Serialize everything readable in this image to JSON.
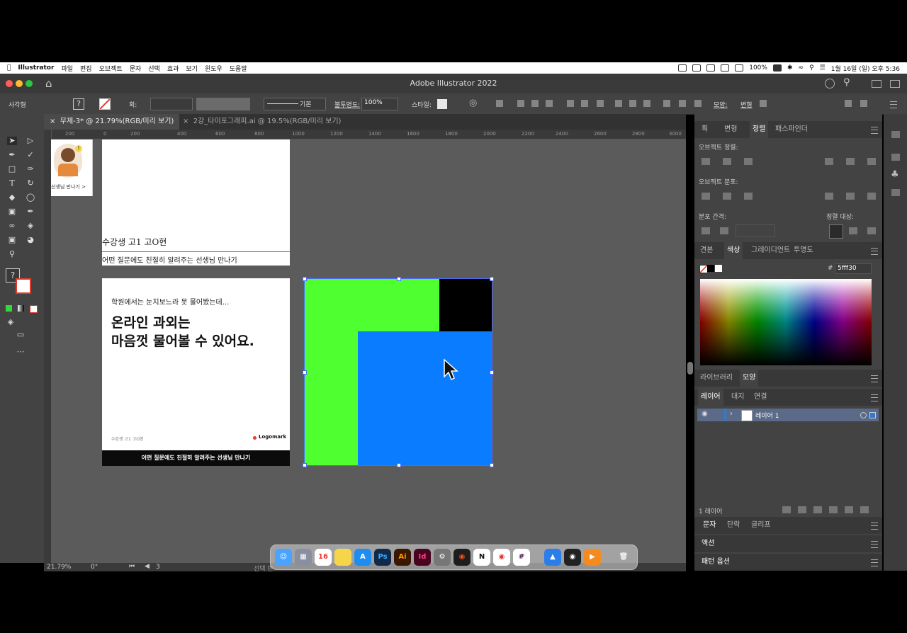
{
  "menubar": {
    "app_name": "Illustrator",
    "items": [
      "파일",
      "편집",
      "오브젝트",
      "문자",
      "선택",
      "효과",
      "보기",
      "윈도우",
      "도움말"
    ],
    "battery": "100%",
    "datetime": "1월 16일 (일) 오후 5:36"
  },
  "window": {
    "title": "Adobe Illustrator 2022"
  },
  "controlbar": {
    "selection_label": "사각형",
    "stroke_label": "획:",
    "stroke_style": "기본",
    "opacity_label": "불투명도:",
    "opacity_value": "100%",
    "style_label": "스타일:",
    "shape_label": "모양:",
    "transform_label": "변형"
  },
  "tabs": [
    {
      "label": "무제-3* @ 21.79%(RGB/미리 보기)",
      "active": true
    },
    {
      "label": "2강_타이포그래피.ai @ 19.5%(RGB/미리 보기)",
      "active": false
    }
  ],
  "ruler": {
    "ticks": [
      "200",
      "0",
      "200",
      "400",
      "600",
      "800",
      "1000",
      "1200",
      "1400",
      "1600",
      "1800",
      "2000",
      "2200",
      "2400",
      "2600",
      "2800",
      "3000"
    ]
  },
  "artboards": {
    "top": {
      "thumb_link": "선생님 만나기 >",
      "caption_student": "수강생 고1 고O현",
      "caption_text": "어떤 질문에도 친절히 알려주는 선생님 만나기"
    },
    "card": {
      "intro": "학원에서는 눈치보느라 못 물어봤는데...",
      "headline_line1": "온라인 과외는",
      "headline_line2": "마음껏 물어볼 수 있어요.",
      "student": "수강생 고1 고O현",
      "logo": "Logomark",
      "footer": "어떤 질문에도 친절히 알려주는 선생님 만나기"
    },
    "shapes": {
      "green": "#4fff30",
      "black": "#000000",
      "blue": "#0a7cff"
    }
  },
  "panels": {
    "align": {
      "tabs": [
        "획",
        "변형",
        "정렬",
        "패스파인더"
      ],
      "active_tab": "정렬",
      "object_align_label": "오브젝트 정렬:",
      "object_distribute_label": "오브젝트 분포:",
      "distribute_spacing_label": "분포 간격:",
      "align_to_label": "정렬 대상:"
    },
    "color": {
      "tabs": [
        "견본",
        "색상",
        "그레이디언트",
        "투명도"
      ],
      "active_tab": "색상",
      "hex_symbol": "#",
      "hex_value": "5fff30"
    },
    "library": {
      "tabs": [
        "라이브러리",
        "모양"
      ],
      "active_tab": "모양"
    },
    "layers": {
      "tabs": [
        "레이어",
        "대지",
        "연결"
      ],
      "active_tab": "레이어",
      "layer_name": "레이어 1",
      "footer_count": "1 레이어"
    },
    "type": {
      "tabs": [
        "문자",
        "단락",
        "글리프"
      ]
    },
    "actions": {
      "label": "액션"
    },
    "pattern": {
      "label": "패턴 옵션"
    }
  },
  "statusbar": {
    "zoom": "21.79%",
    "rotation": "0°",
    "page": "3",
    "tool_hint": "선택 반"
  },
  "dock": {
    "apps": [
      "finder-icon",
      "launchpad-icon",
      "calendar-icon",
      "notes-icon",
      "appstore-icon",
      "photoshop-icon",
      "illustrator-icon",
      "indesign-icon",
      "settings-icon",
      "figma-icon",
      "notion-icon",
      "chrome-icon",
      "slack-icon",
      "keynote-icon",
      "obs-icon",
      "infuse-icon",
      "trash-icon"
    ],
    "calendar_day": "16",
    "ps_label": "Ps",
    "ai_label": "Ai",
    "id_label": "Id",
    "notion_label": "N"
  },
  "colors": {
    "ui_bg": "#434343",
    "canvas": "#5b5b5b",
    "accent_blue": "#2d7bd6",
    "selection": "#4a6cff"
  }
}
